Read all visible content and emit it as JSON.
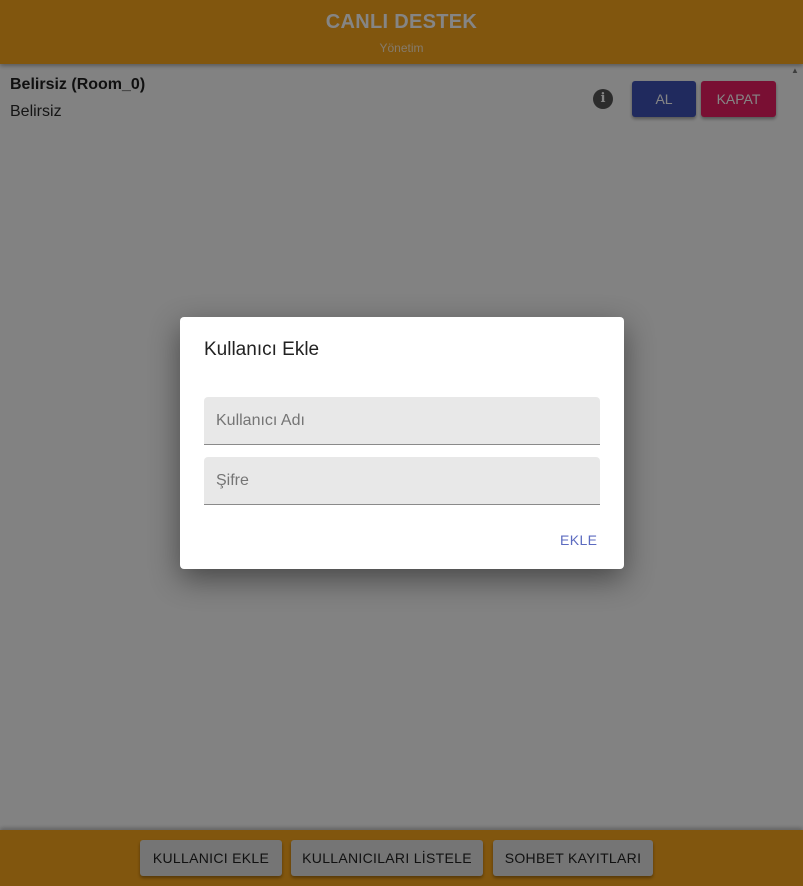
{
  "header": {
    "title": "CANLI DESTEK",
    "subtitle": "Yönetim"
  },
  "room": {
    "name": "Belirsiz (Room_0)",
    "status": "Belirsiz",
    "info_icon": "info-icon",
    "accept_label": "AL",
    "close_label": "KAPAT"
  },
  "dialog": {
    "title": "Kullanıcı Ekle",
    "username_placeholder": "Kullanıcı Adı",
    "username_value": "",
    "password_placeholder": "Şifre",
    "password_value": "",
    "submit_label": "EKLE"
  },
  "footer": {
    "add_user_label": "KULLANICI EKLE",
    "list_users_label": "KULLANICILARI LİSTELE",
    "chat_logs_label": "SOHBET KAYITLARI"
  },
  "colors": {
    "header_bg": "#f8a51b",
    "accept_btn": "#3f51b5",
    "close_btn": "#e91e63",
    "dialog_action": "#5c6bc0"
  }
}
